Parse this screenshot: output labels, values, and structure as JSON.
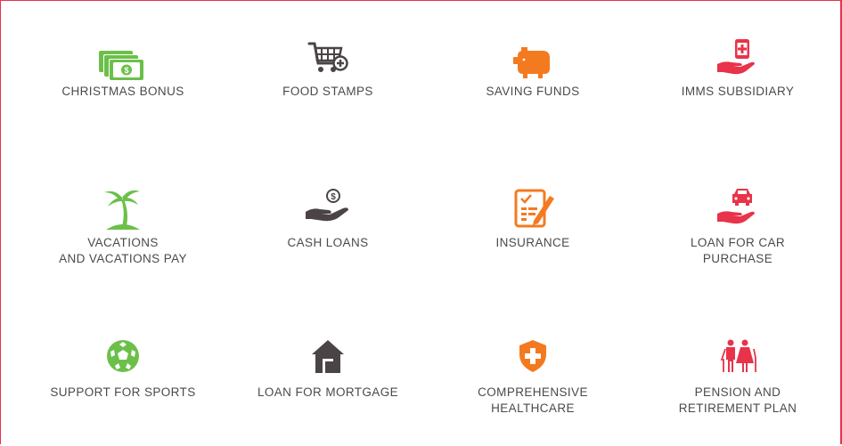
{
  "benefits": [
    {
      "label": "CHRISTMAS BONUS",
      "icon": "money-stack-icon",
      "color": "#6cc04a"
    },
    {
      "label": "FOOD STAMPS",
      "icon": "shopping-cart-add-icon",
      "color": "#4b4446"
    },
    {
      "label": "SAVING FUNDS",
      "icon": "piggy-bank-icon",
      "color": "#f47a20"
    },
    {
      "label": "IMMS SUBSIDIARY",
      "icon": "hand-medical-icon",
      "color": "#e8334a"
    },
    {
      "label": "VACATIONS\nAND VACATIONS PAY",
      "icon": "palm-tree-island-icon",
      "color": "#6cc04a"
    },
    {
      "label": "CASH LOANS",
      "icon": "hand-coin-icon",
      "color": "#4b4446"
    },
    {
      "label": "INSURANCE",
      "icon": "document-checklist-icon",
      "color": "#f47a20"
    },
    {
      "label": "LOAN FOR CAR\nPURCHASE",
      "icon": "hand-car-icon",
      "color": "#e8334a"
    },
    {
      "label": "SUPPORT FOR SPORTS",
      "icon": "soccer-ball-icon",
      "color": "#6cc04a"
    },
    {
      "label": "LOAN FOR MORTGAGE",
      "icon": "house-icon",
      "color": "#4b4446"
    },
    {
      "label": "COMPREHENSIVE\nHEALTHCARE",
      "icon": "shield-cross-icon",
      "color": "#f47a20"
    },
    {
      "label": "PENSION AND\nRETIREMENT PLAN",
      "icon": "elderly-couple-icon",
      "color": "#e8334a"
    }
  ]
}
